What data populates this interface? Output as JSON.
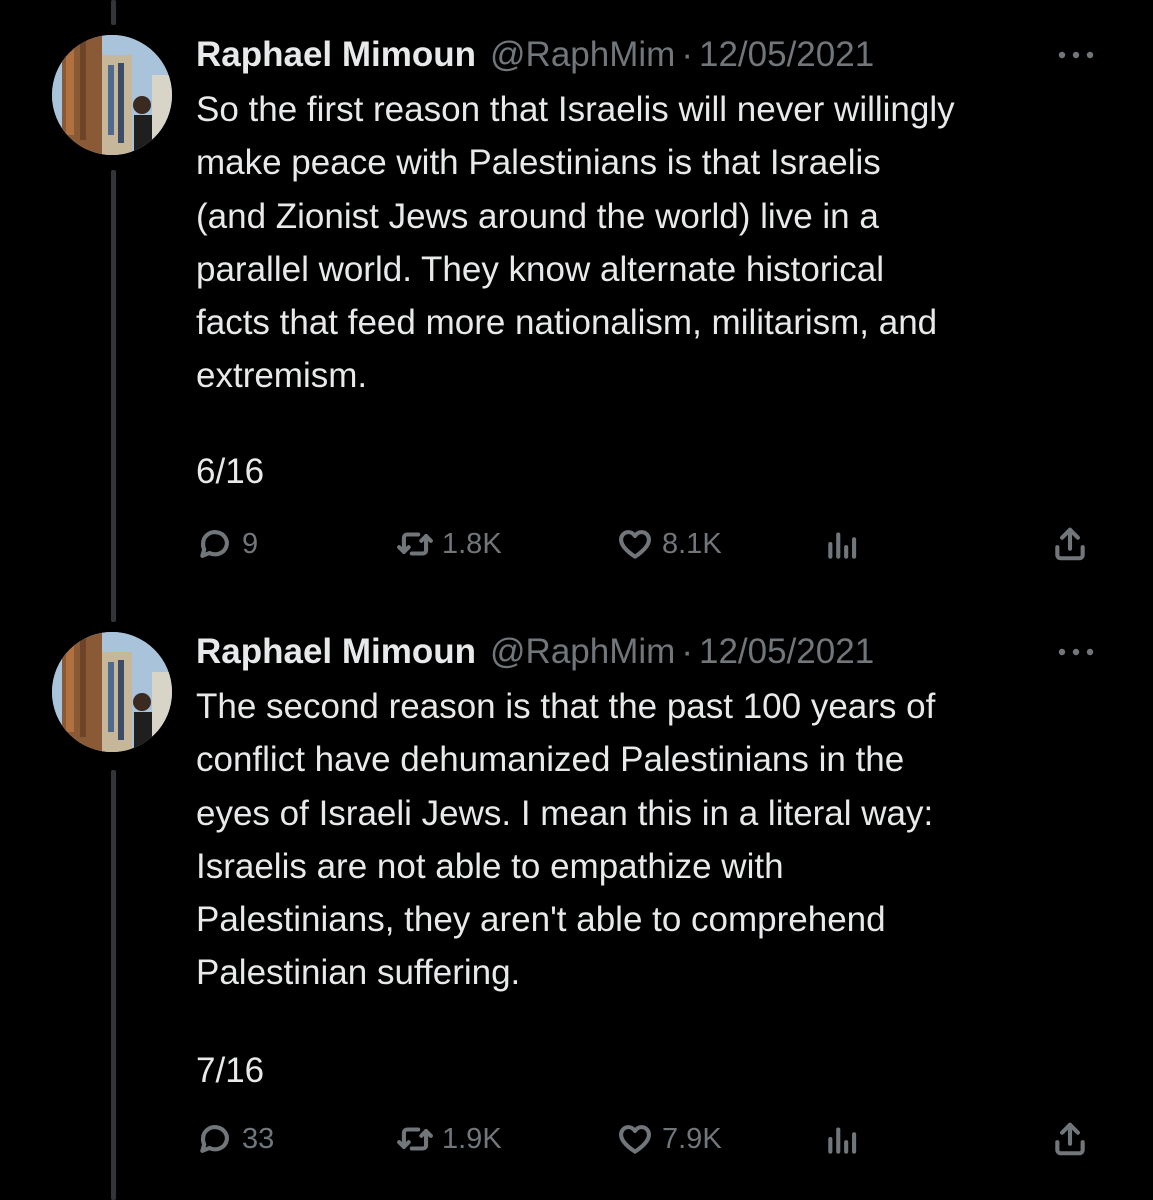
{
  "tweets": [
    {
      "author_name": "Raphael Mimoun",
      "handle": "@RaphMim",
      "separator": "·",
      "date": "12/05/2021",
      "body": "So the first reason that Israelis will never willingly\nmake peace with Palestinians is that Israelis\n(and Zionist Jews around the world) live in a\nparallel world. They know alternate historical\nfacts that feed more nationalism, militarism, and\nextremism.",
      "thread_position": "6/16",
      "replies": "9",
      "retweets": "1.8K",
      "likes": "8.1K"
    },
    {
      "author_name": "Raphael Mimoun",
      "handle": "@RaphMim",
      "separator": "·",
      "date": "12/05/2021",
      "body": "The second reason is that the past 100 years of\nconflict have dehumanized Palestinians in the\neyes of Israeli Jews. I mean this in a literal way:\nIsraelis are not able to empathize with\nPalestinians, they aren't able to comprehend\nPalestinian suffering.",
      "thread_position": "7/16",
      "replies": "33",
      "retweets": "1.9K",
      "likes": "7.9K"
    }
  ],
  "icons": {
    "more": "more-horizontal-icon",
    "reply": "reply-bubble-icon",
    "retweet": "retweet-icon",
    "like": "heart-icon",
    "views": "views-chart-icon",
    "share": "share-upload-icon"
  },
  "colors": {
    "background": "#000000",
    "text_primary": "#e7e9ea",
    "text_secondary": "#71767b",
    "thread_line": "#333639"
  }
}
